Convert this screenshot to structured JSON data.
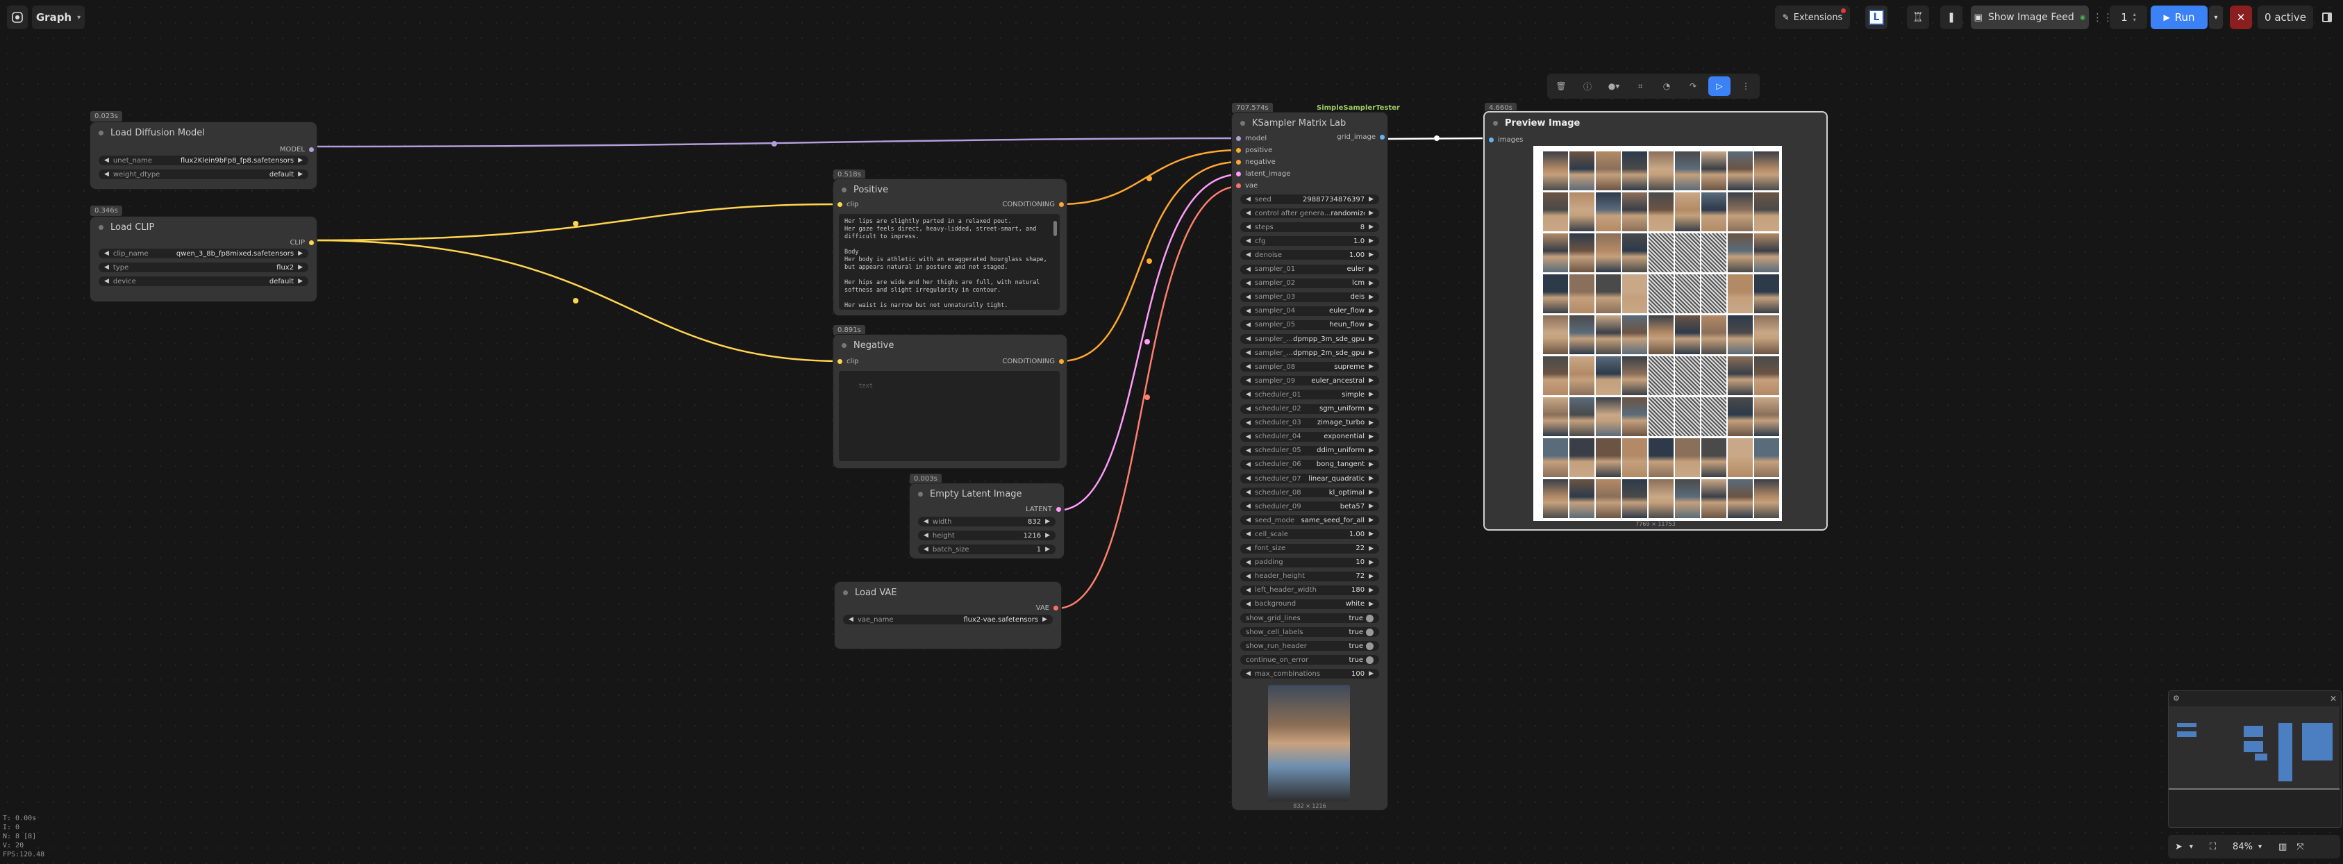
{
  "toolbar": {
    "graph_label": "Graph",
    "extensions_label": "Extensions",
    "show_image_feed_label": "Show Image Feed",
    "queue_count": "1",
    "run_label": "Run",
    "active_label": "0 active"
  },
  "nodes": {
    "load_diffusion": {
      "time": "0.023s",
      "title": "Load Diffusion Model",
      "out": "MODEL",
      "widgets": [
        {
          "label": "unet_name",
          "value": "flux2Klein9bFp8_fp8.safetensors"
        },
        {
          "label": "weight_dtype",
          "value": "default"
        }
      ]
    },
    "load_clip": {
      "time": "0.346s",
      "title": "Load CLIP",
      "out": "CLIP",
      "widgets": [
        {
          "label": "clip_name",
          "value": "qwen_3_8b_fp8mixed.safetensors"
        },
        {
          "label": "type",
          "value": "flux2"
        },
        {
          "label": "device",
          "value": "default"
        }
      ]
    },
    "positive": {
      "time": "0.518s",
      "title": "Positive",
      "in": "clip",
      "out": "CONDITIONING",
      "text": "Her lips are slightly parted in a relaxed pout.\nHer gaze feels direct, heavy-lidded, street-smart, and difficult to impress.\n\nBody\nHer body is athletic with an exaggerated hourglass shape, but appears natural in posture and not staged.\n\nHer hips are wide and her thighs are full, with natural softness and slight irregularity in contour.\n\nHer waist is narrow but not unnaturally tight."
    },
    "negative": {
      "time": "0.891s",
      "title": "Negative",
      "in": "clip",
      "out": "CONDITIONING",
      "placeholder": "text"
    },
    "empty_latent": {
      "time": "0.003s",
      "title": "Empty Latent Image",
      "out": "LATENT",
      "widgets": [
        {
          "label": "width",
          "value": "832"
        },
        {
          "label": "height",
          "value": "1216"
        },
        {
          "label": "batch_size",
          "value": "1"
        }
      ]
    },
    "load_vae": {
      "time": "",
      "title": "Load VAE",
      "out": "VAE",
      "widgets": [
        {
          "label": "vae_name",
          "value": "flux2-vae.safetensors"
        }
      ]
    },
    "ksampler": {
      "time": "707.574s",
      "tag": "SimpleSamplerTester",
      "title": "KSampler Matrix Lab",
      "inputs": [
        "model",
        "positive",
        "negative",
        "latent_image",
        "vae"
      ],
      "out": "grid_image",
      "widgets": [
        {
          "label": "seed",
          "value": "29887734876397",
          "kind": "num"
        },
        {
          "label": "control after genera...",
          "value": "randomize",
          "kind": "combo"
        },
        {
          "label": "steps",
          "value": "8",
          "kind": "num"
        },
        {
          "label": "cfg",
          "value": "1.0",
          "kind": "num"
        },
        {
          "label": "denoise",
          "value": "1.00",
          "kind": "num"
        },
        {
          "label": "sampler_01",
          "value": "euler",
          "kind": "combo"
        },
        {
          "label": "sampler_02",
          "value": "lcm",
          "kind": "combo"
        },
        {
          "label": "sampler_03",
          "value": "deis",
          "kind": "combo"
        },
        {
          "label": "sampler_04",
          "value": "euler_flow",
          "kind": "combo"
        },
        {
          "label": "sampler_05",
          "value": "heun_flow",
          "kind": "combo"
        },
        {
          "label": "sampler_...",
          "value": "dpmpp_3m_sde_gpu",
          "kind": "combo"
        },
        {
          "label": "sampler_...",
          "value": "dpmpp_2m_sde_gpu",
          "kind": "combo"
        },
        {
          "label": "sampler_08",
          "value": "supreme",
          "kind": "combo"
        },
        {
          "label": "sampler_09",
          "value": "euler_ancestral",
          "kind": "combo"
        },
        {
          "label": "scheduler_01",
          "value": "simple",
          "kind": "combo"
        },
        {
          "label": "scheduler_02",
          "value": "sgm_uniform",
          "kind": "combo"
        },
        {
          "label": "scheduler_03",
          "value": "zimage_turbo",
          "kind": "combo"
        },
        {
          "label": "scheduler_04",
          "value": "exponential",
          "kind": "combo"
        },
        {
          "label": "scheduler_05",
          "value": "ddim_uniform",
          "kind": "combo"
        },
        {
          "label": "scheduler_06",
          "value": "bong_tangent",
          "kind": "combo"
        },
        {
          "label": "scheduler_07",
          "value": "linear_quadratic",
          "kind": "combo"
        },
        {
          "label": "scheduler_08",
          "value": "kl_optimal",
          "kind": "combo"
        },
        {
          "label": "scheduler_09",
          "value": "beta57",
          "kind": "combo"
        },
        {
          "label": "seed_mode",
          "value": "same_seed_for_all",
          "kind": "combo"
        },
        {
          "label": "cell_scale",
          "value": "1.00",
          "kind": "num"
        },
        {
          "label": "font_size",
          "value": "22",
          "kind": "num"
        },
        {
          "label": "padding",
          "value": "10",
          "kind": "num"
        },
        {
          "label": "header_height",
          "value": "72",
          "kind": "num"
        },
        {
          "label": "left_header_width",
          "value": "180",
          "kind": "num"
        },
        {
          "label": "background",
          "value": "white",
          "kind": "combo"
        },
        {
          "label": "show_grid_lines",
          "value": "true",
          "kind": "toggle"
        },
        {
          "label": "show_cell_labels",
          "value": "true",
          "kind": "toggle"
        },
        {
          "label": "show_run_header",
          "value": "true",
          "kind": "toggle"
        },
        {
          "label": "continue_on_error",
          "value": "true",
          "kind": "toggle"
        },
        {
          "label": "max_combinations",
          "value": "100",
          "kind": "num"
        }
      ],
      "thumb_caption": "832 × 1216"
    },
    "preview": {
      "time": "4.660s",
      "title": "Preview Image",
      "in": "images",
      "caption": "7769 × 11753"
    }
  },
  "stats": [
    "T: 0.00s",
    "I: 0",
    "N: 8 [8]",
    "V: 20",
    "FPS:120.48"
  ],
  "zoom": "84%",
  "colors": {
    "model": "#b39ddb",
    "clip": "#ffd54f",
    "conditioning": "#ffa931",
    "latent": "#ff9cf9",
    "vae": "#ff6e6e",
    "image": "#64b5f6",
    "accent": "#3b82f6"
  }
}
